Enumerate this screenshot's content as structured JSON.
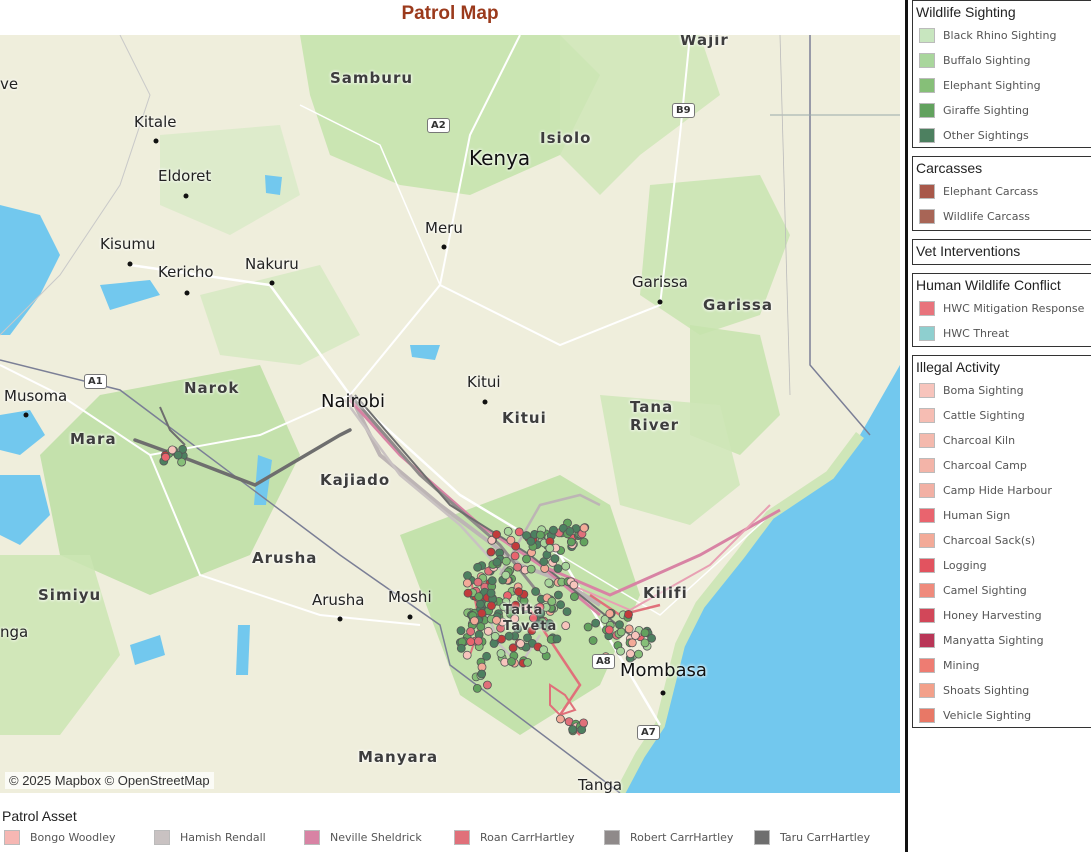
{
  "title": "Patrol Map",
  "map": {
    "attribution": "© 2025 Mapbox © OpenStreetMap",
    "labels": {
      "kenya": "Kenya",
      "samburu": "Samburu",
      "isiolo": "Isiolo",
      "wajir": "Wajir",
      "kitale": "Kitale",
      "eldoret": "Eldoret",
      "kisumu": "Kisumu",
      "kericho": "Kericho",
      "nakuru": "Nakuru",
      "meru": "Meru",
      "garissa_city": "Garissa",
      "garissa_county": "Garissa",
      "narok": "Narok",
      "musoma": "Musoma",
      "mara": "Mara",
      "nairobi": "Nairobi",
      "kitui_city": "Kitui",
      "kitui_county": "Kitui",
      "tana_river": "Tana\nRiver",
      "kajiado": "Kajiado",
      "arusha_region": "Arusha",
      "arusha_city": "Arusha",
      "moshi": "Moshi",
      "simiyu": "Simiyu",
      "nga": "nga",
      "kilifi": "Kilifi",
      "mombasa": "Mombasa",
      "manyara": "Manyara",
      "tanga": "Tanga",
      "taita": "Taita\nTaveta",
      "ve": "ve"
    },
    "shields": {
      "a2": "A2",
      "b9": "B9",
      "a1": "A1",
      "a8": "A8",
      "a7": "A7"
    }
  },
  "legends": {
    "wildlife": {
      "title": "Wildlife Sighting",
      "items": [
        {
          "label": "Black Rhino Sighting",
          "color": "#c8e6bf"
        },
        {
          "label": "Buffalo Sighting",
          "color": "#a9d69c"
        },
        {
          "label": "Elephant Sighting",
          "color": "#86bf78"
        },
        {
          "label": "Giraffe Sighting",
          "color": "#62a25e"
        },
        {
          "label": "Other Sightings",
          "color": "#4d8060"
        }
      ]
    },
    "carcasses": {
      "title": "Carcasses",
      "items": [
        {
          "label": "Elephant Carcass",
          "color": "#a8584a"
        },
        {
          "label": "Wildlife Carcass",
          "color": "#a86556"
        }
      ]
    },
    "vet": {
      "title": "Vet Interventions"
    },
    "hwc": {
      "title": "Human Wildlife Conflict",
      "items": [
        {
          "label": "HWC Mitigation Response",
          "color": "#e8737c"
        },
        {
          "label": "HWC Threat",
          "color": "#8ecfcf"
        }
      ]
    },
    "illegal": {
      "title": "Illegal Activity",
      "items": [
        {
          "label": "Boma Sighting",
          "color": "#f7c4bc"
        },
        {
          "label": "Cattle Sighting",
          "color": "#f6bdb3"
        },
        {
          "label": "Charcoal Kiln",
          "color": "#f4b9ad"
        },
        {
          "label": "Charcoal Camp",
          "color": "#f3b4a8"
        },
        {
          "label": "Camp Hide Harbour",
          "color": "#f2b0a4"
        },
        {
          "label": "Human Sign",
          "color": "#e9646e"
        },
        {
          "label": "Charcoal Sack(s)",
          "color": "#f3aa98"
        },
        {
          "label": "Logging",
          "color": "#e2535f"
        },
        {
          "label": "Camel Sighting",
          "color": "#ef8a7c"
        },
        {
          "label": "Honey Harvesting",
          "color": "#d24759"
        },
        {
          "label": "Manyatta Sighting",
          "color": "#b93657"
        },
        {
          "label": "Mining",
          "color": "#ee7c72"
        },
        {
          "label": "Shoats Sighting",
          "color": "#f3a08a"
        },
        {
          "label": "Vehicle Sighting",
          "color": "#e87866"
        }
      ]
    }
  },
  "patrol_assets": {
    "title": "Patrol Asset",
    "items": [
      {
        "label": "Bongo Woodley",
        "color": "#f6b7b3"
      },
      {
        "label": "Hamish Rendall",
        "color": "#c9c2c2"
      },
      {
        "label": "Neville Sheldrick",
        "color": "#d883a4"
      },
      {
        "label": "Roan CarrHartley",
        "color": "#e0707a"
      },
      {
        "label": "Robert CarrHartley",
        "color": "#8f8a8a"
      },
      {
        "label": "Taru CarrHartley",
        "color": "#6e6e6e"
      }
    ]
  }
}
